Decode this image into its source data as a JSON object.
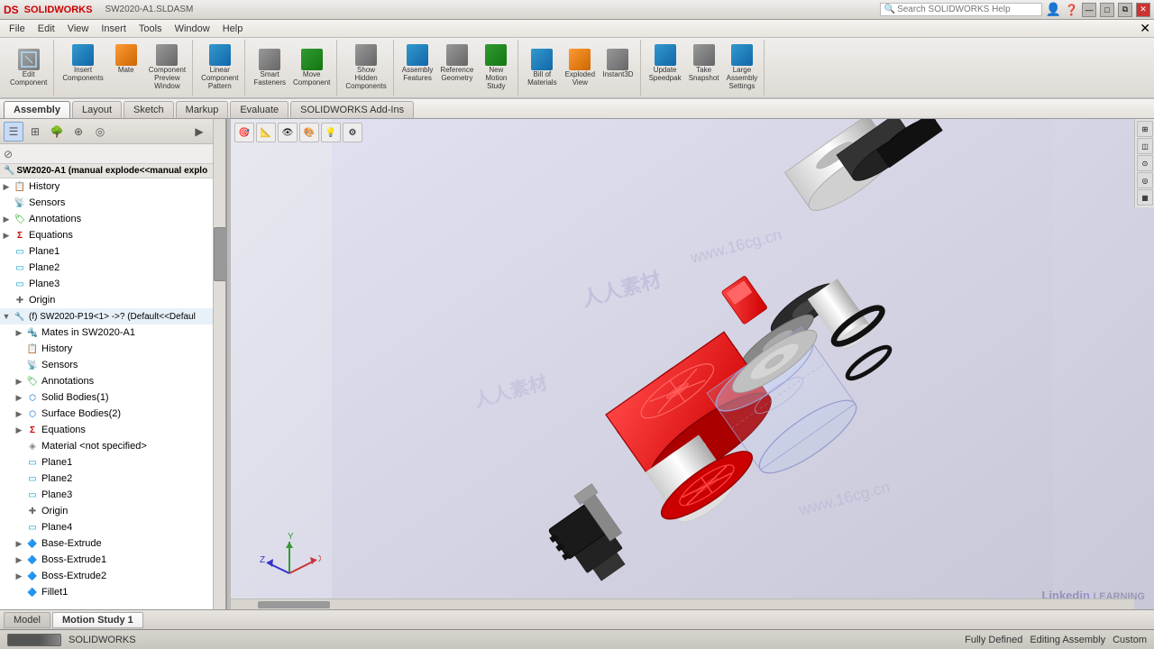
{
  "app": {
    "title": "SW2020-A1.SLDASM",
    "name": "SOLIDWORKS",
    "logo": "DS"
  },
  "titlebar": {
    "title": "SW2020-A1.SLDASM",
    "controls": [
      "—",
      "□",
      "✕"
    ]
  },
  "menubar": {
    "items": [
      "File",
      "Edit",
      "View",
      "Insert",
      "Tools",
      "Window",
      "Help"
    ]
  },
  "toolbar": {
    "groups": [
      {
        "buttons": [
          {
            "icon": "edit-component",
            "label": "Edit\nComponent",
            "color": "gray"
          }
        ]
      },
      {
        "buttons": [
          {
            "icon": "insert-components",
            "label": "Insert\nComponents",
            "color": "blue"
          },
          {
            "icon": "mate",
            "label": "Mate",
            "color": "orange"
          },
          {
            "icon": "component-preview",
            "label": "Component\nPreview\nWindow",
            "color": "gray"
          }
        ]
      },
      {
        "buttons": [
          {
            "icon": "linear-component-pattern",
            "label": "Linear\nComponent\nPattern",
            "color": "blue"
          }
        ]
      },
      {
        "buttons": [
          {
            "icon": "smart-fasteners",
            "label": "Smart\nFasteners",
            "color": "gray"
          },
          {
            "icon": "move-component",
            "label": "Move\nComponent",
            "color": "green"
          }
        ]
      },
      {
        "buttons": [
          {
            "icon": "show-hidden",
            "label": "Show\nHidden\nComponents",
            "color": "gray"
          }
        ]
      },
      {
        "buttons": [
          {
            "icon": "assembly-features",
            "label": "Assembly\nFeatures",
            "color": "blue"
          },
          {
            "icon": "reference-geometry",
            "label": "Reference\nGeometry",
            "color": "gray"
          },
          {
            "icon": "new-motion-study",
            "label": "New\nMotion\nStudy",
            "color": "green"
          }
        ]
      },
      {
        "buttons": [
          {
            "icon": "bill-of-materials",
            "label": "Bill of\nMaterials",
            "color": "blue"
          },
          {
            "icon": "exploded-view",
            "label": "Exploded\nView",
            "color": "orange"
          },
          {
            "icon": "instant3d",
            "label": "Instant3D",
            "color": "gray"
          }
        ]
      },
      {
        "buttons": [
          {
            "icon": "update-speedpak",
            "label": "Update\nSpeedpak",
            "color": "blue"
          },
          {
            "icon": "take-snapshot",
            "label": "Take\nSnapshot",
            "color": "gray"
          },
          {
            "icon": "large-assembly-settings",
            "label": "Large\nAssembly\nSettings",
            "color": "blue"
          }
        ]
      }
    ]
  },
  "tabs": {
    "items": [
      "Assembly",
      "Layout",
      "Sketch",
      "Markup",
      "Evaluate",
      "SOLIDWORKS Add-Ins"
    ]
  },
  "featuremanager": {
    "icons": [
      "list",
      "detail",
      "tree",
      "crosshair",
      "sphere",
      "arrow-right"
    ],
    "title": "SW2020-A1  (manual explode<<manual explo",
    "tree": [
      {
        "level": 0,
        "arrow": "▶",
        "icon": "📋",
        "label": "History",
        "type": "history"
      },
      {
        "level": 0,
        "arrow": "",
        "icon": "📡",
        "label": "Sensors",
        "type": "sensor"
      },
      {
        "level": 0,
        "arrow": "▶",
        "icon": "🏷",
        "label": "Annotations",
        "type": "anno"
      },
      {
        "level": 0,
        "arrow": "▶",
        "icon": "Σ",
        "label": "Equations",
        "type": "equation"
      },
      {
        "level": 0,
        "arrow": "",
        "icon": "□",
        "label": "Plane1",
        "type": "plane"
      },
      {
        "level": 0,
        "arrow": "",
        "icon": "□",
        "label": "Plane2",
        "type": "plane"
      },
      {
        "level": 0,
        "arrow": "",
        "icon": "□",
        "label": "Plane3",
        "type": "plane"
      },
      {
        "level": 0,
        "arrow": "",
        "icon": "✚",
        "label": "Origin",
        "type": "origin"
      },
      {
        "level": 0,
        "arrow": "▼",
        "icon": "🔧",
        "label": "(f) SW2020-P19<1> ->? (Default<<Defaul",
        "type": "component"
      },
      {
        "level": 1,
        "arrow": "▶",
        "icon": "🔩",
        "label": "Mates in SW2020-A1",
        "type": "mate"
      },
      {
        "level": 1,
        "arrow": "",
        "icon": "📋",
        "label": "History",
        "type": "history"
      },
      {
        "level": 1,
        "arrow": "",
        "icon": "📡",
        "label": "Sensors",
        "type": "sensor"
      },
      {
        "level": 1,
        "arrow": "▶",
        "icon": "🏷",
        "label": "Annotations",
        "type": "anno"
      },
      {
        "level": 1,
        "arrow": "▶",
        "icon": "⬡",
        "label": "Solid Bodies(1)",
        "type": "body"
      },
      {
        "level": 1,
        "arrow": "▶",
        "icon": "⬡",
        "label": "Surface Bodies(2)",
        "type": "body"
      },
      {
        "level": 1,
        "arrow": "▶",
        "icon": "Σ",
        "label": "Equations",
        "type": "equation"
      },
      {
        "level": 1,
        "arrow": "",
        "icon": "🔶",
        "label": "Material <not specified>",
        "type": "material"
      },
      {
        "level": 1,
        "arrow": "",
        "icon": "□",
        "label": "Plane1",
        "type": "plane"
      },
      {
        "level": 1,
        "arrow": "",
        "icon": "□",
        "label": "Plane2",
        "type": "plane"
      },
      {
        "level": 1,
        "arrow": "",
        "icon": "□",
        "label": "Plane3",
        "type": "plane"
      },
      {
        "level": 1,
        "arrow": "",
        "icon": "✚",
        "label": "Origin",
        "type": "origin"
      },
      {
        "level": 1,
        "arrow": "",
        "icon": "□",
        "label": "Plane4",
        "type": "plane"
      },
      {
        "level": 1,
        "arrow": "▶",
        "icon": "🔷",
        "label": "Base-Extrude",
        "type": "feature"
      },
      {
        "level": 1,
        "arrow": "▶",
        "icon": "🔷",
        "label": "Boss-Extrude1",
        "type": "feature"
      },
      {
        "level": 1,
        "arrow": "▶",
        "icon": "🔷",
        "label": "Boss-Extrude2",
        "type": "feature"
      },
      {
        "level": 1,
        "arrow": "",
        "icon": "🔷",
        "label": "Fillet1",
        "type": "feature"
      }
    ]
  },
  "bottomtabs": {
    "items": [
      "Model",
      "Motion Study 1"
    ]
  },
  "statusbar": {
    "app_name": "SOLIDWORKS",
    "status": "Fully Defined",
    "mode": "Editing Assembly",
    "view_mode": "Custom",
    "indicator_segments": 3
  },
  "searchbar": {
    "placeholder": "Search SOLIDWORKS Help"
  },
  "viewport": {
    "watermarks": [
      "人人素材",
      "www.16cg.cn"
    ]
  }
}
